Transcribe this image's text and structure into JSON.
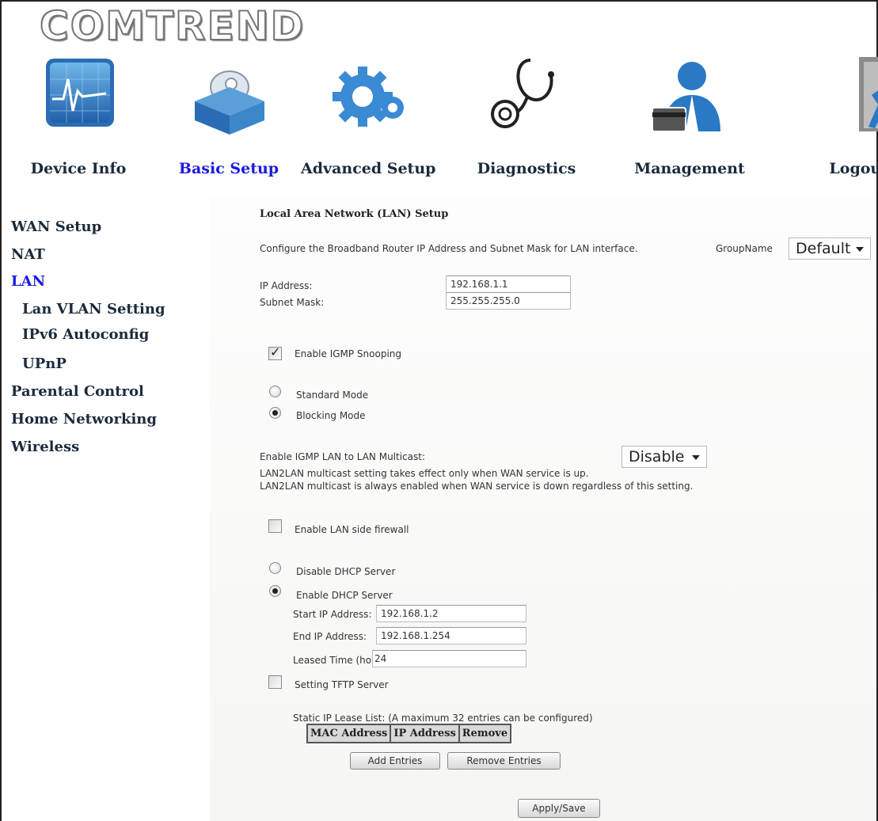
{
  "brand": {
    "logo_text": "COMTREND"
  },
  "nav": {
    "items": [
      {
        "label": "Device Info",
        "icon": "pulse-monitor-icon",
        "active": false
      },
      {
        "label": "Basic Setup",
        "icon": "box-disc-icon",
        "active": true
      },
      {
        "label": "Advanced Setup",
        "icon": "gears-icon",
        "active": false
      },
      {
        "label": "Diagnostics",
        "icon": "stethoscope-icon",
        "active": false
      },
      {
        "label": "Management",
        "icon": "user-card-icon",
        "active": false
      },
      {
        "label": "Logout",
        "icon": "exit-door-icon",
        "active": false
      }
    ]
  },
  "sidebar": {
    "items": [
      {
        "label": "WAN Setup",
        "active": false,
        "level": 0
      },
      {
        "label": "NAT",
        "active": false,
        "level": 0
      },
      {
        "label": "LAN",
        "active": true,
        "level": 0
      },
      {
        "label": "Lan VLAN Setting",
        "active": false,
        "level": 1
      },
      {
        "label": "IPv6 Autoconfig",
        "active": false,
        "level": 1
      },
      {
        "label": "UPnP",
        "active": false,
        "level": 1
      },
      {
        "label": "Parental Control",
        "active": false,
        "level": 0
      },
      {
        "label": "Home Networking",
        "active": false,
        "level": 0
      },
      {
        "label": "Wireless",
        "active": false,
        "level": 0
      }
    ]
  },
  "main": {
    "title": "Local Area Network (LAN) Setup",
    "description": "Configure the Broadband Router IP Address and Subnet Mask for LAN interface.",
    "group_name_label": "GroupName",
    "group_name_value": "Default",
    "ip_address_label": "IP Address:",
    "ip_address_value": "192.168.1.1",
    "subnet_mask_label": "Subnet Mask:",
    "subnet_mask_value": "255.255.255.0",
    "igmp_snooping": {
      "label": "Enable IGMP Snooping",
      "checked": true
    },
    "standard_mode": {
      "label": "Standard Mode",
      "selected": false
    },
    "blocking_mode": {
      "label": "Blocking Mode",
      "selected": true
    },
    "lan2lan": {
      "label": "Enable IGMP LAN to LAN Multicast:",
      "value": "Disable",
      "note1": "LAN2LAN multicast setting takes effect only when WAN service is up.",
      "note2": "LAN2LAN multicast is always enabled when WAN service is down regardless of this setting."
    },
    "lan_firewall": {
      "label": "Enable LAN side firewall",
      "checked": false
    },
    "disable_dhcp": {
      "label": "Disable DHCP Server",
      "selected": false
    },
    "enable_dhcp": {
      "label": "Enable DHCP Server",
      "selected": true
    },
    "dhcp": {
      "start_label": "Start IP Address:",
      "start_value": "192.168.1.2",
      "end_label": "End IP Address:",
      "end_value": "192.168.1.254",
      "lease_label": "Leased Time (hour):",
      "lease_value": "24"
    },
    "tftp": {
      "label": "Setting TFTP Server",
      "checked": false
    },
    "static_lease": {
      "label": "Static IP Lease List: (A maximum 32 entries can be configured)",
      "columns": [
        "MAC Address",
        "IP Address",
        "Remove"
      ]
    },
    "add_entries_label": "Add Entries",
    "remove_entries_label": "Remove Entries",
    "apply_save_label": "Apply/Save"
  }
}
